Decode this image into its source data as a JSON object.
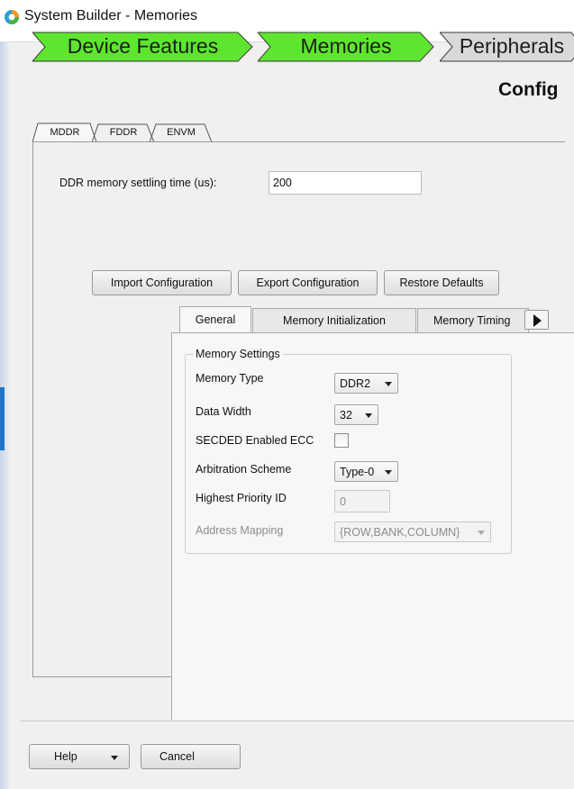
{
  "window": {
    "title": "System Builder - Memories"
  },
  "wizard": {
    "steps": [
      {
        "label": "Device Features",
        "state": "complete"
      },
      {
        "label": "Memories",
        "state": "current"
      },
      {
        "label": "Peripherals",
        "state": "pending"
      }
    ],
    "heading": "Config"
  },
  "colors": {
    "step_active": "#5ee62f",
    "step_inactive": "#d9d9d9",
    "accent": "#1e73c8"
  },
  "outer_tabs": [
    "MDDR",
    "FDDR",
    "ENVM"
  ],
  "settling": {
    "label": "DDR memory settling time (us):",
    "value": "200"
  },
  "buttons": {
    "import": "Import Configuration",
    "export": "Export Configuration",
    "restore": "Restore Defaults",
    "help": "Help",
    "cancel": "Cancel"
  },
  "inner_tabs": [
    "General",
    "Memory Initialization",
    "Memory Timing"
  ],
  "memory_settings": {
    "title": "Memory Settings",
    "memory_type": {
      "label": "Memory Type",
      "value": "DDR2"
    },
    "data_width": {
      "label": "Data Width",
      "value": "32"
    },
    "secded": {
      "label": "SECDED Enabled ECC",
      "checked": false
    },
    "arbitration": {
      "label": "Arbitration Scheme",
      "value": "Type-0"
    },
    "highest_priority": {
      "label": "Highest Priority ID",
      "value": "0"
    },
    "address_mapping": {
      "label": "Address Mapping",
      "value": "{ROW,BANK,COLUMN}"
    }
  }
}
